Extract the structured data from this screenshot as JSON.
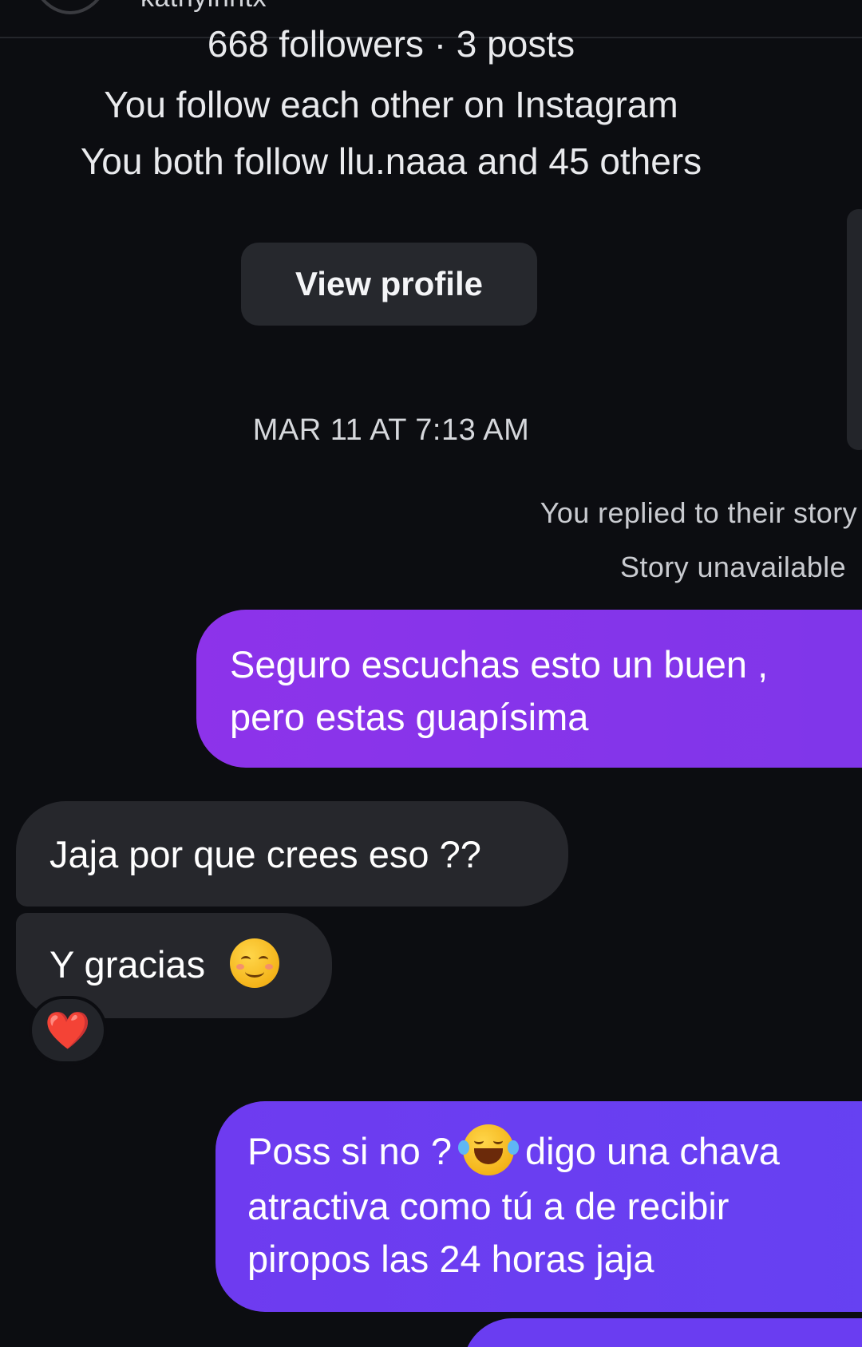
{
  "header": {
    "username_partial": "kathyinntx",
    "followers_line": "668 followers · 3 posts",
    "mutual_follow_line": "You follow each other on Instagram",
    "both_follow_line": "You both follow llu.naaa and 45 others",
    "view_profile_label": "View profile"
  },
  "thread": {
    "timestamp": "MAR 11 AT 7:13 AM",
    "replied_label": "You replied to their story",
    "story_unavailable": "Story unavailable",
    "messages": [
      {
        "direction": "outgoing",
        "text": "Seguro escuchas esto un buen , pero estas guapísima"
      },
      {
        "direction": "incoming",
        "text": "Jaja por que crees eso ??"
      },
      {
        "direction": "incoming",
        "text": "Y gracias",
        "emoji": "smiling-face-icon",
        "reaction": "❤️"
      },
      {
        "direction": "outgoing",
        "text_before": "Poss si no ?",
        "emoji": "tears-of-joy-icon",
        "text_after": "digo una chava atractiva como tú a de recibir piropos las 24 horas jaja"
      }
    ]
  },
  "colors": {
    "background": "#0c0d11",
    "incoming_bubble": "#26272c",
    "outgoing_bubble_1": "#8d33ea",
    "outgoing_bubble_2": "#6e3bf0",
    "reaction_heart": "#ea2a3a"
  }
}
